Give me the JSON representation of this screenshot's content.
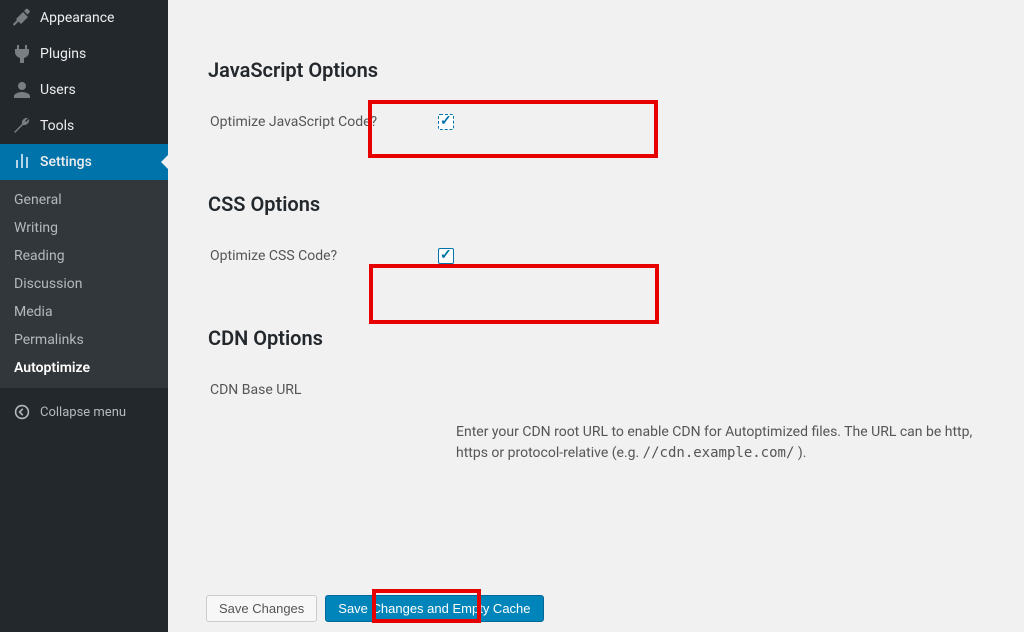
{
  "sidebar": {
    "menu": [
      {
        "label": "Appearance",
        "icon": "appearance"
      },
      {
        "label": "Plugins",
        "icon": "plugins"
      },
      {
        "label": "Users",
        "icon": "users"
      },
      {
        "label": "Tools",
        "icon": "tools"
      },
      {
        "label": "Settings",
        "icon": "settings",
        "active": true
      }
    ],
    "submenu": [
      "General",
      "Writing",
      "Reading",
      "Discussion",
      "Media",
      "Permalinks",
      "Autoptimize"
    ],
    "submenu_current": "Autoptimize",
    "collapse_label": "Collapse menu"
  },
  "content": {
    "js_section_title": "JavaScript Options",
    "js_row_label": "Optimize JavaScript Code?",
    "js_checked": true,
    "css_section_title": "CSS Options",
    "css_row_label": "Optimize CSS Code?",
    "css_checked": true,
    "cdn_section_title": "CDN Options",
    "cdn_row_label": "CDN Base URL",
    "cdn_desc_prefix": "Enter your CDN root URL to enable CDN for Autoptimized files. The URL can be http, https or protocol-relative (e.g. ",
    "cdn_desc_example": "//cdn.example.com/",
    "cdn_desc_suffix": " )."
  },
  "buttons": {
    "save": "Save Changes",
    "save_empty": "Save Changes and Empty Cache"
  },
  "colors": {
    "highlight": "#e60000",
    "primary": "#0073aa"
  }
}
